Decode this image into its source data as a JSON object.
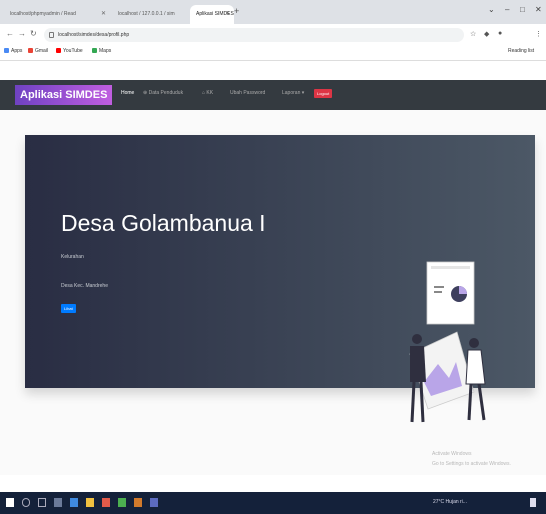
{
  "browser": {
    "tabs": [
      {
        "label": "localhost/phpmyadmin / Read"
      },
      {
        "label": "localhost / 127.0.0.1 / sim"
      },
      {
        "label": "Aplikasi SIMDES"
      }
    ],
    "url": "localhost/simdes/desa/profil.php",
    "bookmarks": [
      {
        "label": "Apps",
        "color": "#4a8af4"
      },
      {
        "label": "Gmail",
        "color": "#ea4335"
      },
      {
        "label": "YouTube",
        "color": "#ff0000"
      },
      {
        "label": "Maps",
        "color": "#34a853"
      }
    ],
    "reading_list": "Reading list"
  },
  "app": {
    "brand": "Aplikasi SIMDES",
    "nav": {
      "home": "Home",
      "data_penduduk": "Data Penduduk",
      "kk": "KK",
      "ubah_password": "Ubah Password",
      "laporan": "Laporan",
      "logout": "Logout"
    },
    "hero": {
      "title": "Desa Golambanua I",
      "lead": "Kelurahan",
      "text": "Desa Kec. Mandrehe",
      "button": "Lihat"
    },
    "watermark": {
      "line1": "Activate Windows",
      "line2": "Go to Settings to activate Windows."
    }
  },
  "taskbar": {
    "tray": "27°C Hujan ri..."
  },
  "colors": {
    "navbar": "#343a40",
    "brand_start": "#6f42c1",
    "brand_end": "#c05ee0",
    "hero_start": "#292d43",
    "hero_end": "#4c5866",
    "logout": "#dc3545",
    "primary": "#007bff",
    "taskbar": "#14213a"
  }
}
